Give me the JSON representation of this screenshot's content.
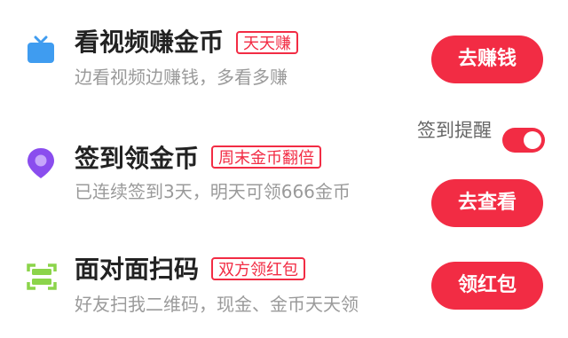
{
  "tasks": [
    {
      "icon": "tv-icon",
      "title": "看视频赚金币",
      "tag": "天天赚",
      "subtitle": "边看视频边赚钱，多看多赚",
      "button": "去赚钱"
    },
    {
      "icon": "location-pin-icon",
      "title": "签到领金币",
      "tag": "周末金币翻倍",
      "subtitle": "已连续签到3天，明天可领666金币",
      "button": "去查看",
      "reminder_label": "签到提醒",
      "reminder_on": true
    },
    {
      "icon": "scan-icon",
      "title": "面对面扫码",
      "tag": "双方领红包",
      "subtitle": "好友扫我二维码，现金、金币天天领",
      "button": "领红包"
    }
  ],
  "colors": {
    "accent": "#f22c44",
    "tv_icon": "#3f9cf0",
    "pin_icon": "#8a4dee",
    "scan_icon": "#8bd44a"
  }
}
